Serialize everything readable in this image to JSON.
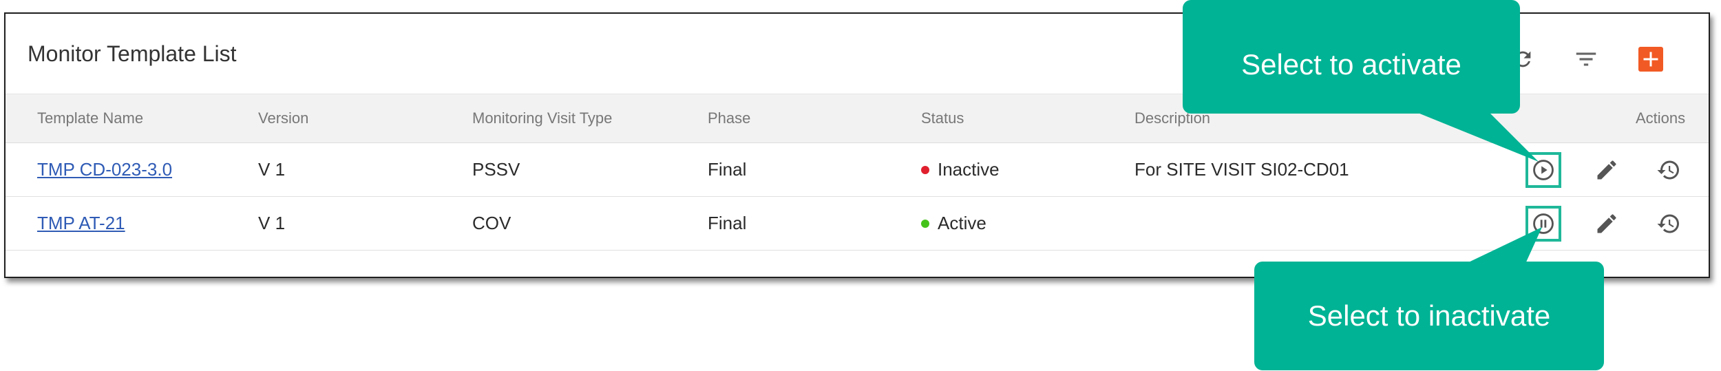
{
  "panel": {
    "title": "Monitor Template List"
  },
  "toolbar": {
    "refresh_icon": "refresh-icon",
    "filter_icon": "filter-icon",
    "add_icon": "add-icon",
    "add_color": "#f15a24"
  },
  "table": {
    "headers": [
      "Template Name",
      "Version",
      "Monitoring Visit Type",
      "Phase",
      "Status",
      "Description",
      "Actions"
    ],
    "rows": [
      {
        "name": "TMP CD-023-3.0",
        "version": "V 1",
        "visit_type": "PSSV",
        "phase": "Final",
        "status": "Inactive",
        "status_color": "#e0202e",
        "description": "For SITE VISIT SI02-CD01",
        "toggle_icon": "play-circle-icon"
      },
      {
        "name": "TMP AT-21",
        "version": "V 1",
        "visit_type": "COV",
        "phase": "Final",
        "status": "Active",
        "status_color": "#45c21a",
        "description": "",
        "toggle_icon": "pause-circle-icon"
      }
    ]
  },
  "callouts": {
    "activate": "Select to activate",
    "inactivate": "Select to inactivate",
    "color": "#00b394"
  }
}
